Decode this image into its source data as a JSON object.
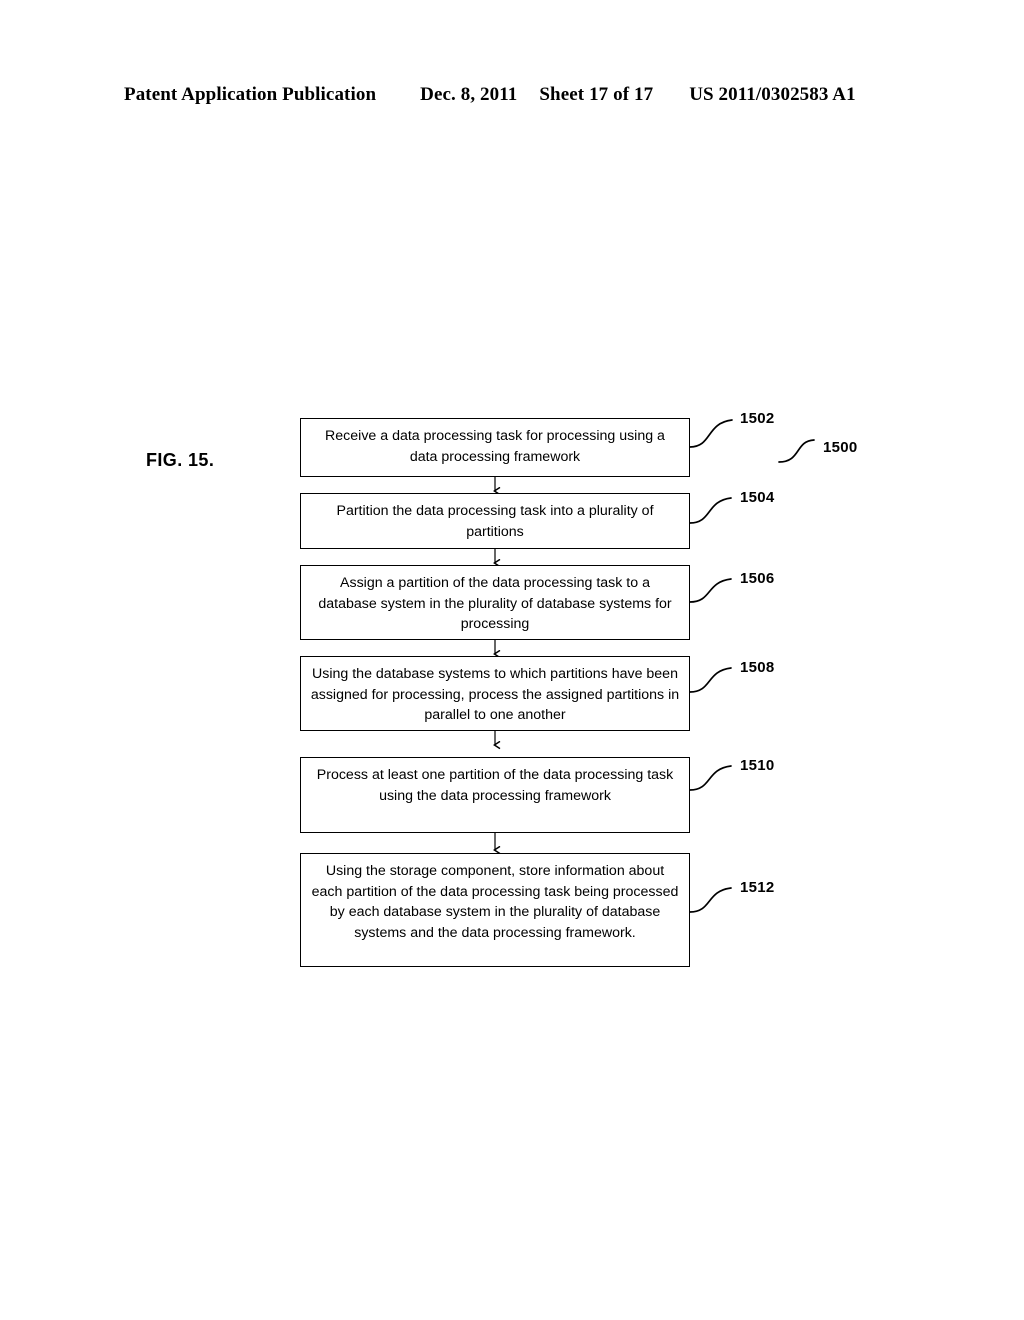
{
  "header": {
    "publication": "Patent Application Publication",
    "date": "Dec. 8, 2011",
    "sheet": "Sheet 17 of 17",
    "doc_number": "US 2011/0302583 A1"
  },
  "figure": {
    "label": "FIG. 15.",
    "diagram_ref": "1500",
    "type": "flowchart",
    "orientation": "vertical",
    "line_color": "#000000",
    "background_color": "#ffffff"
  },
  "flowchart": {
    "steps": [
      {
        "ref": "1502",
        "text": "Receive a data processing task for processing using a data processing framework"
      },
      {
        "ref": "1504",
        "text": "Partition the data processing task into a plurality of partitions"
      },
      {
        "ref": "1506",
        "text": "Assign a partition of the data processing task to a database system in the plurality of database systems for processing"
      },
      {
        "ref": "1508",
        "text": "Using the database systems to which partitions have been assigned for processing, process the assigned partitions in parallel to one another"
      },
      {
        "ref": "1510",
        "text": "Process at least one partition of the data processing task using the data processing framework"
      },
      {
        "ref": "1512",
        "text": "Using the storage component, store information about each partition of the data processing task being processed by each database system in the plurality of database systems and the data processing framework."
      }
    ]
  }
}
